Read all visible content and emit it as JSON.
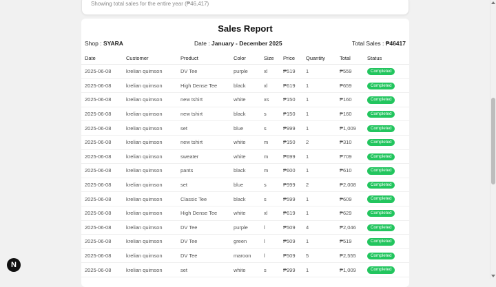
{
  "summary_note": "Showing total sales for the entire year (₱46,417)",
  "report": {
    "title": "Sales Report",
    "shop_label": "Shop : ",
    "shop_name": "SYARA",
    "date_label": "Date : ",
    "date_value": "January - December 2025",
    "total_label": "Total Sales : ",
    "total_value": "₱46417"
  },
  "columns": [
    "Date",
    "Customer",
    "Product",
    "Color",
    "Size",
    "Price",
    "Quantity",
    "Total",
    "Status"
  ],
  "rows": [
    [
      "2025-06-08",
      "krelian quimson",
      "DV Tee",
      "purple",
      "xl",
      "₱519",
      "1",
      "₱559",
      "Completed"
    ],
    [
      "2025-06-08",
      "krelian quimson",
      "High Dense Tee",
      "black",
      "xl",
      "₱619",
      "1",
      "₱659",
      "Completed"
    ],
    [
      "2025-06-08",
      "krelian quimson",
      "new tshirt",
      "white",
      "xs",
      "₱150",
      "1",
      "₱160",
      "Completed"
    ],
    [
      "2025-06-08",
      "krelian quimson",
      "new tshirt",
      "black",
      "s",
      "₱150",
      "1",
      "₱160",
      "Completed"
    ],
    [
      "2025-06-08",
      "krelian quimson",
      "set",
      "blue",
      "s",
      "₱999",
      "1",
      "₱1,009",
      "Completed"
    ],
    [
      "2025-06-08",
      "krelian quimson",
      "new tshirt",
      "white",
      "m",
      "₱150",
      "2",
      "₱310",
      "Completed"
    ],
    [
      "2025-06-08",
      "krelian quimson",
      "sweater",
      "white",
      "m",
      "₱699",
      "1",
      "₱709",
      "Completed"
    ],
    [
      "2025-06-08",
      "krelian quimson",
      "pants",
      "black",
      "m",
      "₱600",
      "1",
      "₱610",
      "Completed"
    ],
    [
      "2025-06-08",
      "krelian quimson",
      "set",
      "blue",
      "s",
      "₱999",
      "2",
      "₱2,008",
      "Completed"
    ],
    [
      "2025-06-08",
      "krelian quimson",
      "Classic Tee",
      "black",
      "s",
      "₱599",
      "1",
      "₱609",
      "Completed"
    ],
    [
      "2025-06-08",
      "krelian quimson",
      "High Dense Tee",
      "white",
      "xl",
      "₱619",
      "1",
      "₱629",
      "Completed"
    ],
    [
      "2025-06-08",
      "krelian quimson",
      "DV Tee",
      "purple",
      "l",
      "₱509",
      "4",
      "₱2,046",
      "Completed"
    ],
    [
      "2025-06-08",
      "krelian quimson",
      "DV Tee",
      "green",
      "l",
      "₱509",
      "1",
      "₱519",
      "Completed"
    ],
    [
      "2025-06-08",
      "krelian quimson",
      "DV Tee",
      "maroon",
      "l",
      "₱509",
      "5",
      "₱2,555",
      "Completed"
    ],
    [
      "2025-06-08",
      "krelian quimson",
      "set",
      "white",
      "s",
      "₱999",
      "1",
      "₱1,009",
      "Completed"
    ]
  ],
  "dev_badge": "N",
  "colors": {
    "status_completed": "#22c55e",
    "background": "#f1f1f1"
  }
}
